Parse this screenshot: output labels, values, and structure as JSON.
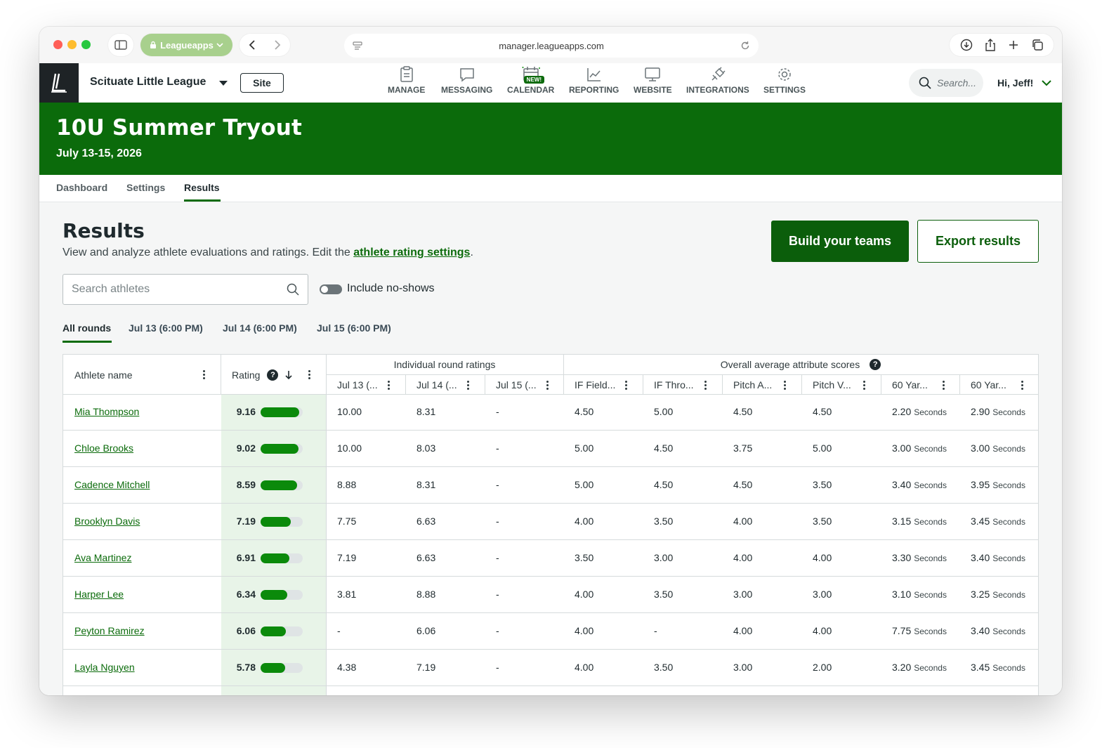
{
  "browser": {
    "tab_group_label": "Leagueapps",
    "url": "manager.leagueapps.com"
  },
  "header": {
    "org_name": "Scituate Little League",
    "site_button": "Site",
    "nav": [
      {
        "label": "MANAGE",
        "icon": "clipboard-icon"
      },
      {
        "label": "MESSAGING",
        "icon": "chat-icon"
      },
      {
        "label": "CALENDAR",
        "icon": "calendar-icon",
        "badge": "NEW!"
      },
      {
        "label": "REPORTING",
        "icon": "chart-icon"
      },
      {
        "label": "WEBSITE",
        "icon": "monitor-icon"
      },
      {
        "label": "INTEGRATIONS",
        "icon": "plug-icon"
      },
      {
        "label": "SETTINGS",
        "icon": "gear-icon"
      }
    ],
    "search_placeholder": "Search...",
    "user_greeting": "Hi, Jeff!"
  },
  "banner": {
    "title": "10U Summer Tryout",
    "date": "July 13-15, 2026"
  },
  "subtabs": [
    "Dashboard",
    "Settings",
    "Results"
  ],
  "results": {
    "title": "Results",
    "description": "View and analyze athlete evaluations and ratings. Edit the ",
    "link_text": "athlete rating settings",
    "period": ".",
    "build_button": "Build your teams",
    "export_button": "Export results",
    "search_placeholder": "Search athletes",
    "toggle_label": "Include no-shows",
    "round_tabs": [
      "All rounds",
      "Jul 13 (6:00 PM)",
      "Jul 14 (6:00 PM)",
      "Jul 15 (6:00 PM)"
    ]
  },
  "table": {
    "col_athlete": "Athlete name",
    "col_rating": "Rating",
    "group_individual": "Individual round ratings",
    "group_overall": "Overall average attribute scores",
    "sub_headers": [
      "Jul 13 (...",
      "Jul 14 (...",
      "Jul 15 (...",
      "IF Field...",
      "IF Thro...",
      "Pitch A...",
      "Pitch V...",
      "60 Yar...",
      "60 Yar..."
    ],
    "unit": "Seconds",
    "rows": [
      {
        "name": "Mia Thompson",
        "rating": "9.16",
        "rating_fraction": 0.916,
        "r1": "10.00",
        "r2": "8.31",
        "r3": "-",
        "a1": "4.50",
        "a2": "5.00",
        "a3": "4.50",
        "a4": "4.50",
        "t1": "2.20",
        "t2": "2.90"
      },
      {
        "name": "Chloe Brooks",
        "rating": "9.02",
        "rating_fraction": 0.902,
        "r1": "10.00",
        "r2": "8.03",
        "r3": "-",
        "a1": "5.00",
        "a2": "4.50",
        "a3": "3.75",
        "a4": "5.00",
        "t1": "3.00",
        "t2": "3.00"
      },
      {
        "name": "Cadence Mitchell",
        "rating": "8.59",
        "rating_fraction": 0.859,
        "r1": "8.88",
        "r2": "8.31",
        "r3": "-",
        "a1": "5.00",
        "a2": "4.50",
        "a3": "4.50",
        "a4": "3.50",
        "t1": "3.40",
        "t2": "3.95"
      },
      {
        "name": "Brooklyn Davis",
        "rating": "7.19",
        "rating_fraction": 0.719,
        "r1": "7.75",
        "r2": "6.63",
        "r3": "-",
        "a1": "4.00",
        "a2": "3.50",
        "a3": "4.00",
        "a4": "3.50",
        "t1": "3.15",
        "t2": "3.45"
      },
      {
        "name": "Ava Martinez",
        "rating": "6.91",
        "rating_fraction": 0.691,
        "r1": "7.19",
        "r2": "6.63",
        "r3": "-",
        "a1": "3.50",
        "a2": "3.00",
        "a3": "4.00",
        "a4": "4.00",
        "t1": "3.30",
        "t2": "3.40"
      },
      {
        "name": "Harper Lee",
        "rating": "6.34",
        "rating_fraction": 0.634,
        "r1": "3.81",
        "r2": "8.88",
        "r3": "-",
        "a1": "4.00",
        "a2": "3.50",
        "a3": "3.00",
        "a4": "3.00",
        "t1": "3.10",
        "t2": "3.25"
      },
      {
        "name": "Peyton Ramirez",
        "rating": "6.06",
        "rating_fraction": 0.606,
        "r1": "-",
        "r2": "6.06",
        "r3": "-",
        "a1": "4.00",
        "a2": "-",
        "a3": "4.00",
        "a4": "4.00",
        "t1": "7.75",
        "t2": "3.40"
      },
      {
        "name": "Layla Nguyen",
        "rating": "5.78",
        "rating_fraction": 0.578,
        "r1": "4.38",
        "r2": "7.19",
        "r3": "-",
        "a1": "4.00",
        "a2": "3.50",
        "a3": "3.00",
        "a4": "2.00",
        "t1": "3.20",
        "t2": "3.45"
      }
    ]
  },
  "colors": {
    "brand_green": "#0b6b0b",
    "bar_green": "#0b8a0b",
    "rating_column_bg": "#e8f4e8"
  }
}
